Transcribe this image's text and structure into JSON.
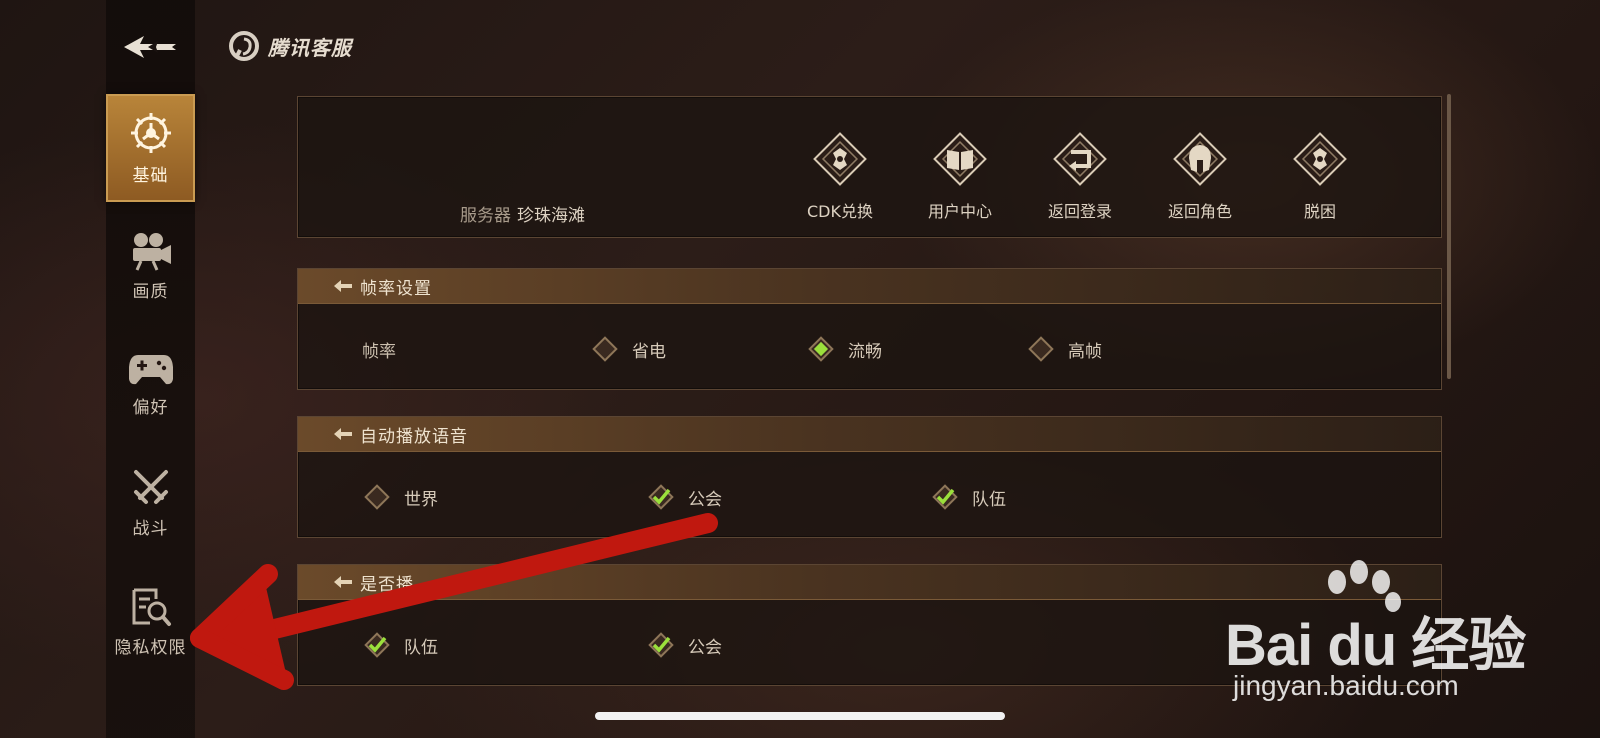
{
  "brand": {
    "text": "腾讯客服"
  },
  "sidebar": {
    "items": [
      {
        "label": "基础",
        "icon": "gear-wheel-icon",
        "active": true
      },
      {
        "label": "画质",
        "icon": "camera-icon",
        "active": false
      },
      {
        "label": "偏好",
        "icon": "gamepad-icon",
        "active": false
      },
      {
        "label": "战斗",
        "icon": "crossed-swords-icon",
        "active": false
      },
      {
        "label": "隐私权限",
        "icon": "privacy-search-icon",
        "active": false
      }
    ]
  },
  "top_panel": {
    "server_label": "服务器",
    "server_value": "珍珠海滩",
    "actions": [
      {
        "label": "CDK兑换",
        "icon": "cdk-diamond-icon"
      },
      {
        "label": "用户中心",
        "icon": "book-icon"
      },
      {
        "label": "返回登录",
        "icon": "return-arrow-icon"
      },
      {
        "label": "返回角色",
        "icon": "helmet-icon"
      },
      {
        "label": "脱困",
        "icon": "unstuck-icon"
      }
    ]
  },
  "framerate": {
    "title": "帧率设置",
    "row_label": "帧率",
    "options": [
      {
        "label": "省电",
        "selected": false
      },
      {
        "label": "流畅",
        "selected": true
      },
      {
        "label": "高帧",
        "selected": false
      }
    ]
  },
  "autoplay_voice": {
    "title": "自动播放语音",
    "options": [
      {
        "label": "世界",
        "checked": false
      },
      {
        "label": "公会",
        "checked": true
      },
      {
        "label": "队伍",
        "checked": true
      }
    ]
  },
  "play_section": {
    "title": "是否播",
    "options": [
      {
        "label": "队伍",
        "checked": true
      },
      {
        "label": "公会",
        "checked": true
      }
    ]
  },
  "watermark": {
    "main": "Bai du 经验",
    "sub": "jingyan.baidu.com"
  },
  "colors": {
    "accent": "#b9853a",
    "check": "#9be03c",
    "arrow": "#c0180f"
  }
}
